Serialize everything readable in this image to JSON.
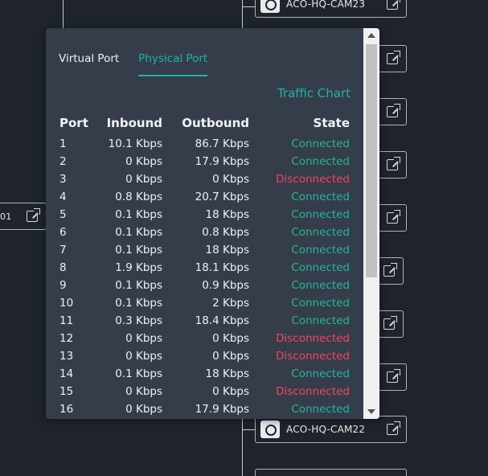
{
  "nodes": {
    "top": "ACO-HQ-CAM23",
    "bottom": "ACO-HQ-CAM22",
    "left_fragment": "01"
  },
  "panel": {
    "tabs": [
      {
        "label": "Virtual Port",
        "active": false
      },
      {
        "label": "Physical Port",
        "active": true
      }
    ],
    "traffic_chart_label": "Traffic Chart",
    "columns": {
      "port": "Port",
      "inbound": "Inbound",
      "outbound": "Outbound",
      "state": "State"
    },
    "rows": [
      {
        "port": "1",
        "inbound": "10.1 Kbps",
        "outbound": "86.7 Kbps",
        "state": "Connected"
      },
      {
        "port": "2",
        "inbound": "0 Kbps",
        "outbound": "17.9 Kbps",
        "state": "Connected"
      },
      {
        "port": "3",
        "inbound": "0 Kbps",
        "outbound": "0 Kbps",
        "state": "Disconnected"
      },
      {
        "port": "4",
        "inbound": "0.8 Kbps",
        "outbound": "20.7 Kbps",
        "state": "Connected"
      },
      {
        "port": "5",
        "inbound": "0.1 Kbps",
        "outbound": "18 Kbps",
        "state": "Connected"
      },
      {
        "port": "6",
        "inbound": "0.1 Kbps",
        "outbound": "0.8 Kbps",
        "state": "Connected"
      },
      {
        "port": "7",
        "inbound": "0.1 Kbps",
        "outbound": "18 Kbps",
        "state": "Connected"
      },
      {
        "port": "8",
        "inbound": "1.9 Kbps",
        "outbound": "18.1 Kbps",
        "state": "Connected"
      },
      {
        "port": "9",
        "inbound": "0.1 Kbps",
        "outbound": "0.9 Kbps",
        "state": "Connected"
      },
      {
        "port": "10",
        "inbound": "0.1 Kbps",
        "outbound": "2 Kbps",
        "state": "Connected"
      },
      {
        "port": "11",
        "inbound": "0.3 Kbps",
        "outbound": "18.4 Kbps",
        "state": "Connected"
      },
      {
        "port": "12",
        "inbound": "0 Kbps",
        "outbound": "0 Kbps",
        "state": "Disconnected"
      },
      {
        "port": "13",
        "inbound": "0 Kbps",
        "outbound": "0 Kbps",
        "state": "Disconnected"
      },
      {
        "port": "14",
        "inbound": "0.1 Kbps",
        "outbound": "18 Kbps",
        "state": "Connected"
      },
      {
        "port": "15",
        "inbound": "0 Kbps",
        "outbound": "0 Kbps",
        "state": "Disconnected"
      },
      {
        "port": "16",
        "inbound": "0 Kbps",
        "outbound": "17.9 Kbps",
        "state": "Connected"
      }
    ]
  },
  "colors": {
    "accent": "#1fb3a4",
    "connected": "#1fb89a",
    "disconnected": "#f0455f",
    "panel": "#363d4a",
    "background": "#1f232c"
  }
}
